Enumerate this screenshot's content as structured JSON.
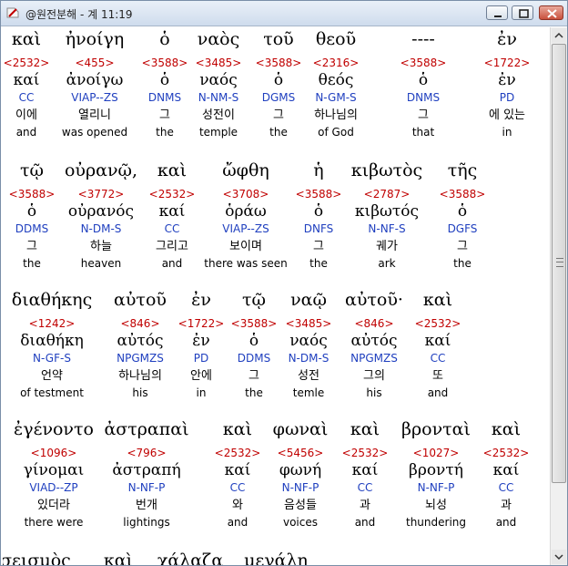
{
  "window": {
    "title": "@원전분해 - 계 11:19",
    "colors": {
      "strong": "#c00000",
      "parse": "#1f3fbf"
    },
    "controls": [
      "minimize",
      "maximize",
      "close"
    ]
  },
  "verse": [
    [
      {
        "greek": "καὶ",
        "strong": "<2532>",
        "lemma": "καί",
        "parse": "CC",
        "korean": "이에",
        "english": "and"
      },
      {
        "greek": "ἠνοίγη",
        "strong": "<455>",
        "lemma": "ἀνοίγω",
        "parse": "VIAP--ZS",
        "korean": "열리니",
        "english": "was opened"
      },
      {
        "greek": "ὁ",
        "strong": "<3588>",
        "lemma": "ὁ",
        "parse": "DNMS",
        "korean": "그",
        "english": "the"
      },
      {
        "greek": "ναὸς",
        "strong": "<3485>",
        "lemma": "ναός",
        "parse": "N-NM-S",
        "korean": "성전이",
        "english": "temple"
      },
      {
        "greek": "τοῦ",
        "strong": "<3588>",
        "lemma": "ὁ",
        "parse": "DGMS",
        "korean": "그",
        "english": "the"
      },
      {
        "greek": "θεοῦ",
        "strong": "<2316>",
        "lemma": "θεός",
        "parse": "N-GM-S",
        "korean": "하나님의",
        "english": "of God"
      },
      {
        "greek": "----",
        "strong": "<3588>",
        "lemma": "ὁ",
        "parse": "DNMS",
        "korean": "그",
        "english": "that"
      },
      {
        "greek": "ἐν",
        "strong": "<1722>",
        "lemma": "ἐν",
        "parse": "PD",
        "korean": "에 있는",
        "english": "in"
      }
    ],
    [
      {
        "greek": "τῷ",
        "strong": "<3588>",
        "lemma": "ὁ",
        "parse": "DDMS",
        "korean": "그",
        "english": "the"
      },
      {
        "greek": "οὐρανῷ,",
        "strong": "<3772>",
        "lemma": "οὐρανός",
        "parse": "N-DM-S",
        "korean": "하늘",
        "english": "heaven"
      },
      {
        "greek": "καὶ",
        "strong": "<2532>",
        "lemma": "καί",
        "parse": "CC",
        "korean": "그리고",
        "english": "and"
      },
      {
        "greek": "ὤφθη",
        "strong": "<3708>",
        "lemma": "ὁράω",
        "parse": "VIAP--ZS",
        "korean": "보이며",
        "english": "there was seen"
      },
      {
        "greek": "ἡ",
        "strong": "<3588>",
        "lemma": "ὁ",
        "parse": "DNFS",
        "korean": "그",
        "english": "the"
      },
      {
        "greek": "κιβωτὸς",
        "strong": "<2787>",
        "lemma": "κιβωτός",
        "parse": "N-NF-S",
        "korean": "궤가",
        "english": "ark"
      },
      {
        "greek": "τῆς",
        "strong": "<3588>",
        "lemma": "ὁ",
        "parse": "DGFS",
        "korean": "그",
        "english": "the"
      }
    ],
    [
      {
        "greek": "διαθήκης",
        "strong": "<1242>",
        "lemma": "διαθήκη",
        "parse": "N-GF-S",
        "korean": "언약",
        "english": "of testment"
      },
      {
        "greek": "αὐτοῦ",
        "strong": "<846>",
        "lemma": "αὐτός",
        "parse": "NPGMZS",
        "korean": "하나님의",
        "english": "his"
      },
      {
        "greek": "ἐν",
        "strong": "<1722>",
        "lemma": "ἐν",
        "parse": "PD",
        "korean": "안에",
        "english": "in"
      },
      {
        "greek": "τῷ",
        "strong": "<3588>",
        "lemma": "ὁ",
        "parse": "DDMS",
        "korean": "그",
        "english": "the"
      },
      {
        "greek": "ναῷ",
        "strong": "<3485>",
        "lemma": "ναός",
        "parse": "N-DM-S",
        "korean": "성전",
        "english": "temle"
      },
      {
        "greek": "αὐτοῦ·",
        "strong": "<846>",
        "lemma": "αὐτός",
        "parse": "NPGMZS",
        "korean": "그의",
        "english": "his"
      },
      {
        "greek": "καὶ",
        "strong": "<2532>",
        "lemma": "καί",
        "parse": "CC",
        "korean": "또",
        "english": "and"
      }
    ],
    [
      {
        "greek": "ἐγένοντο",
        "strong": "<1096>",
        "lemma": "γίνομαι",
        "parse": "VIAD--ZP",
        "korean": "있더라",
        "english": "there were"
      },
      {
        "greek": "ἀστραπαὶ",
        "strong": "<796>",
        "lemma": "ἀστραπή",
        "parse": "N-NF-P",
        "korean": "번개",
        "english": "lightings"
      },
      {
        "greek": "καὶ",
        "strong": "<2532>",
        "lemma": "καί",
        "parse": "CC",
        "korean": "와",
        "english": "and"
      },
      {
        "greek": "φωναὶ",
        "strong": "<5456>",
        "lemma": "φωνή",
        "parse": "N-NF-P",
        "korean": "음성들",
        "english": "voices"
      },
      {
        "greek": "καὶ",
        "strong": "<2532>",
        "lemma": "καί",
        "parse": "CC",
        "korean": "과",
        "english": "and"
      },
      {
        "greek": "βρονταὶ",
        "strong": "<1027>",
        "lemma": "βροντή",
        "parse": "N-NF-P",
        "korean": "뇌성",
        "english": "thundering"
      },
      {
        "greek": "καὶ",
        "strong": "<2532>",
        "lemma": "καί",
        "parse": "CC",
        "korean": "과",
        "english": "and"
      }
    ],
    [
      {
        "greek": "σεισμὸς"
      },
      {
        "greek": "καὶ"
      },
      {
        "greek": "χάλαζα"
      },
      {
        "greek": "μεγάλη"
      }
    ]
  ]
}
